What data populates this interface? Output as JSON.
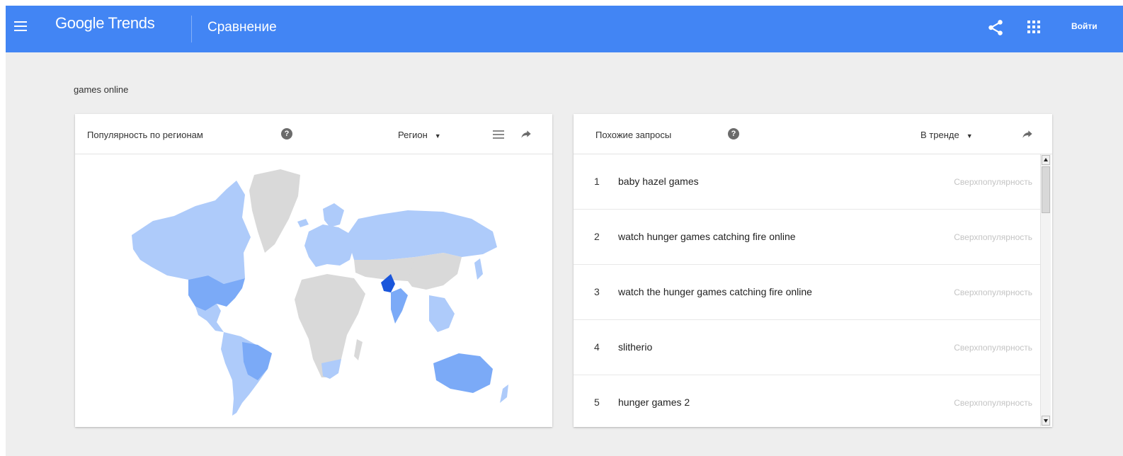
{
  "header": {
    "logo": "Google Trends",
    "page_title": "Сравнение",
    "signin_label": "Войти",
    "icons": [
      "menu-icon",
      "share-icon",
      "apps-grid-icon"
    ]
  },
  "query_label": "games online",
  "colors": {
    "header_bg": "#4285f4",
    "map_low": "#aecbfa",
    "map_mid": "#7baaf7",
    "map_high": "#1a56db",
    "map_none": "#d9d9d9"
  },
  "map_card": {
    "title": "Популярность по регионам",
    "dropdown": "Регион",
    "icons": [
      "help-icon",
      "caret-down-icon",
      "list-icon",
      "forward-arrow-icon"
    ]
  },
  "related_card": {
    "title": "Похожие запросы",
    "dropdown": "В тренде",
    "rows": [
      {
        "rank": "1",
        "term": "baby hazel games",
        "value": "Сверхпопулярность"
      },
      {
        "rank": "2",
        "term": "watch hunger games catching fire online",
        "value": "Сверхпопулярность"
      },
      {
        "rank": "3",
        "term": "watch the hunger games catching fire online",
        "value": "Сверхпопулярность"
      },
      {
        "rank": "4",
        "term": "slitherio",
        "value": "Сверхпопулярность"
      },
      {
        "rank": "5",
        "term": "hunger games 2",
        "value": "Сверхпопулярность"
      }
    ]
  }
}
